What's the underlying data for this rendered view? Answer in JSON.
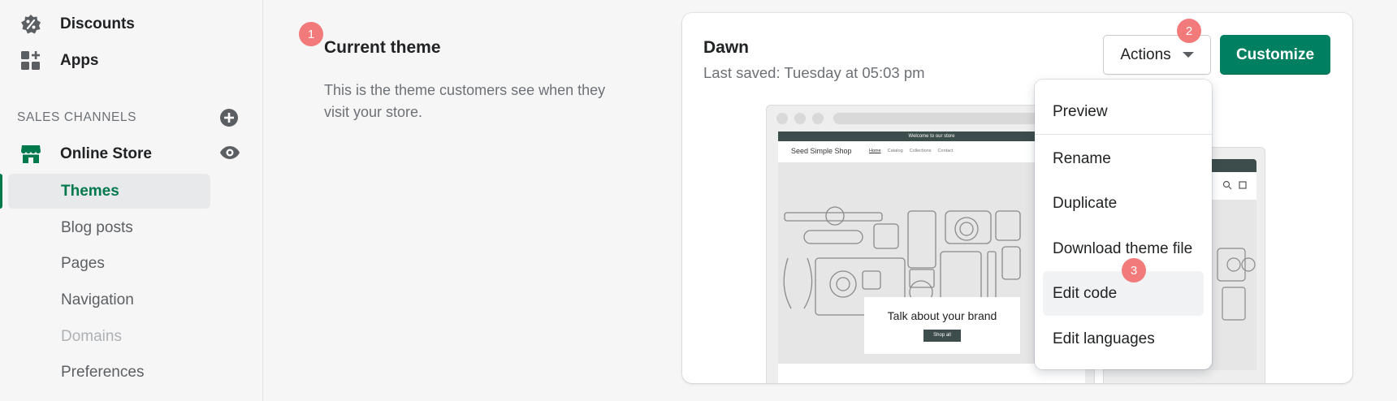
{
  "sidebar": {
    "top_items": [
      {
        "label": "Discounts",
        "icon": "discount-icon"
      },
      {
        "label": "Apps",
        "icon": "apps-icon"
      }
    ],
    "section_label": "SALES CHANNELS",
    "online_store": {
      "label": "Online Store",
      "icon": "store-icon"
    },
    "sub_items": [
      {
        "label": "Themes",
        "state": "active"
      },
      {
        "label": "Blog posts"
      },
      {
        "label": "Pages"
      },
      {
        "label": "Navigation"
      },
      {
        "label": "Domains",
        "state": "muted"
      },
      {
        "label": "Preferences"
      }
    ]
  },
  "main": {
    "title": "Current theme",
    "description": "This is the theme customers see when they visit your store."
  },
  "card": {
    "theme_name": "Dawn",
    "last_saved": "Last saved: Tuesday at 05:03 pm",
    "actions_label": "Actions",
    "customize_label": "Customize"
  },
  "preview": {
    "announcement": "Welcome to our store",
    "shop_name": "Seed Simple Shop",
    "nav": [
      "Home",
      "Catalog",
      "Collections",
      "Contact"
    ],
    "hero_text": "Talk about your brand",
    "hero_button": "Shop all"
  },
  "menu": {
    "items": [
      "Preview",
      "Rename",
      "Duplicate",
      "Download theme file",
      "Edit code",
      "Edit languages"
    ],
    "highlighted": "Edit code"
  },
  "badges": [
    "1",
    "2",
    "3"
  ],
  "colors": {
    "accent": "#008060",
    "active_text": "#007a4d",
    "badge": "#f27a7a"
  }
}
